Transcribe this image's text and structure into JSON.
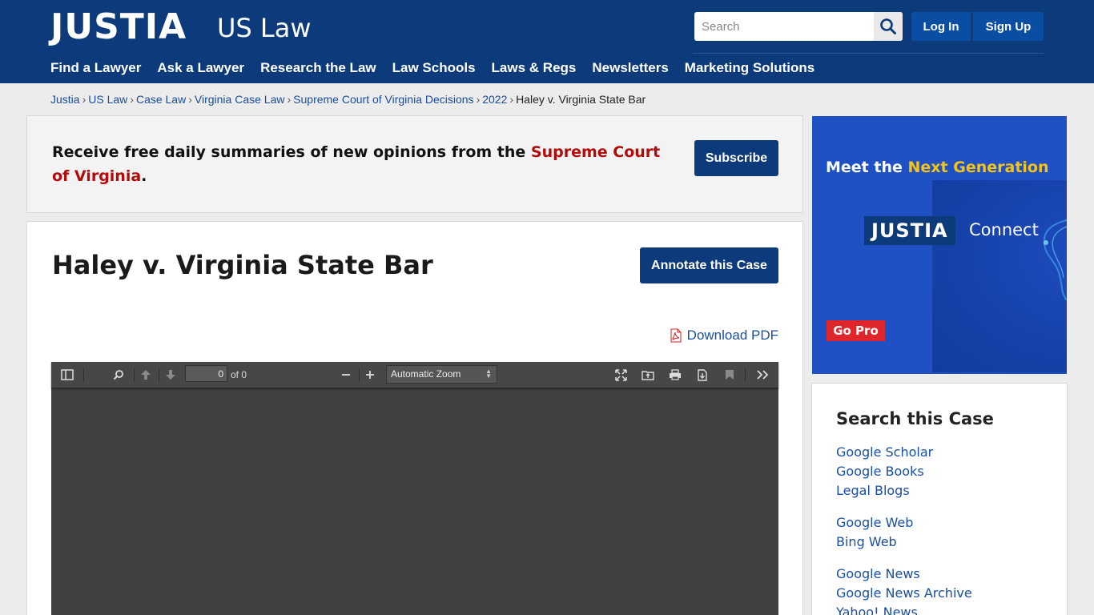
{
  "header": {
    "logo": "JUSTIA",
    "logo_sub": "US Law",
    "search_placeholder": "Search",
    "login_label": "Log In",
    "signup_label": "Sign Up",
    "nav": [
      "Find a Lawyer",
      "Ask a Lawyer",
      "Research the Law",
      "Law Schools",
      "Laws & Regs",
      "Newsletters",
      "Marketing Solutions"
    ]
  },
  "breadcrumb": {
    "items": [
      "Justia",
      "US Law",
      "Case Law",
      "Virginia Case Law",
      "Supreme Court of Virginia Decisions",
      "2022"
    ],
    "separator": "›",
    "current": "Haley v. Virginia State Bar"
  },
  "subscribe": {
    "text_before": "Receive free daily summaries of new opinions from the ",
    "court": "Supreme Court of Virginia",
    "text_after": ".",
    "button": "Subscribe"
  },
  "case": {
    "title": "Haley v. Virginia State Bar",
    "annotate_button": "Annotate this Case",
    "download_label": "Download PDF"
  },
  "pdf_viewer": {
    "page_value": "0",
    "page_of": "of 0",
    "zoom": "Automatic Zoom"
  },
  "ad": {
    "headline_before": "Meet the ",
    "headline_highlight": "Next Generation",
    "logo": "JUSTIA",
    "logo_sub": "Connect",
    "cta": "Go Pro"
  },
  "sidebar": {
    "title": "Search this Case",
    "groups": [
      [
        "Google Scholar",
        "Google Books",
        "Legal Blogs"
      ],
      [
        "Google Web",
        "Bing Web"
      ],
      [
        "Google News",
        "Google News Archive",
        "Yahoo! News"
      ]
    ]
  },
  "colors": {
    "brand_navy": "#0d3a7b",
    "link_blue": "#1a4ea0",
    "court_red": "#b20b0b",
    "ad_blue": "#1f51c4",
    "ad_yellow": "#f3c316",
    "cta_red": "#e0262d"
  }
}
